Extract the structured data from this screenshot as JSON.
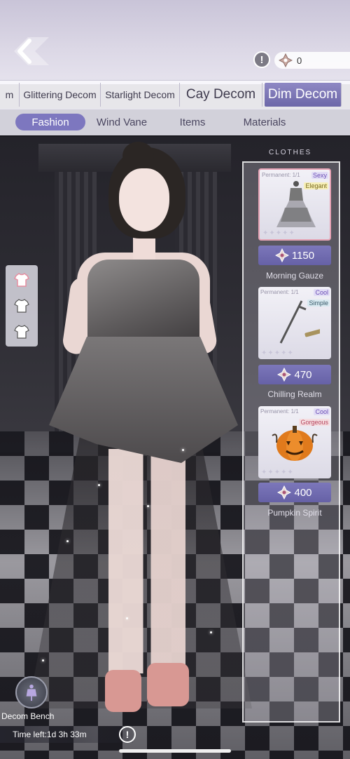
{
  "topbar": {
    "currency_value": "0",
    "hint_label": "!"
  },
  "categories": [
    {
      "label": "m",
      "size": "small"
    },
    {
      "label": "Glittering Decom",
      "size": "small"
    },
    {
      "label": "Starlight Decom",
      "size": "small"
    },
    {
      "label": "Cay Decom",
      "size": "large"
    },
    {
      "label": "Dim Decom",
      "size": "large",
      "active": true
    }
  ],
  "subtabs": [
    {
      "label": "Fashion",
      "active": true
    },
    {
      "label": "Wind Vane"
    },
    {
      "label": "Items"
    },
    {
      "label": "Materials"
    }
  ],
  "panel": {
    "header": "CLOTHES"
  },
  "items": [
    {
      "permanent": "Permanent: 1/1",
      "tags": [
        "Sexy",
        "Elegant"
      ],
      "price": "1150",
      "name": "Morning Gauze"
    },
    {
      "permanent": "Permanent: 1/1",
      "tags": [
        "Cool",
        "Simple"
      ],
      "price": "470",
      "name": "Chilling Realm"
    },
    {
      "permanent": "Permanent: 1/1",
      "tags": [
        "Cool",
        "Gorgeous"
      ],
      "price": "400",
      "name": "Pumpkin Spirit"
    }
  ],
  "bottom": {
    "bench_label": "Decom Bench",
    "time_left": "Time left:1d 3h 33m",
    "info_label": "!"
  },
  "colors": {
    "accent": "#7d77bf",
    "selected_border": "#e7a3b5"
  }
}
